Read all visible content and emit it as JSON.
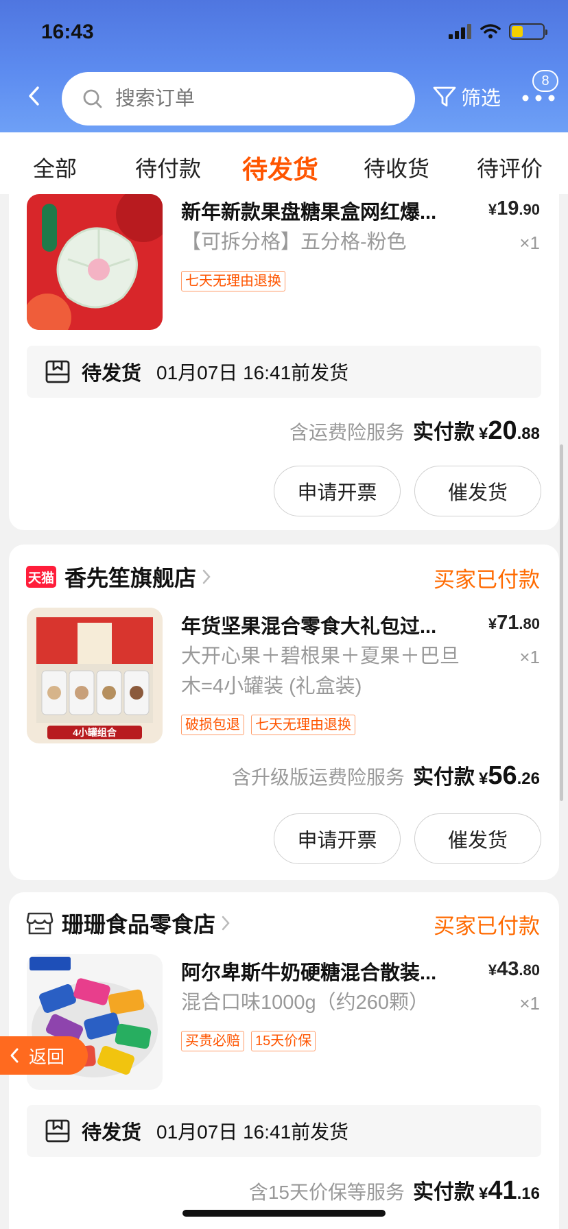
{
  "status_bar": {
    "time": "16:43"
  },
  "header": {
    "search_placeholder": "搜索订单",
    "filter_label": "筛选",
    "more_badge": "8"
  },
  "tabs": [
    {
      "label": "全部",
      "active": false
    },
    {
      "label": "待付款",
      "active": false
    },
    {
      "label": "待发货",
      "active": true
    },
    {
      "label": "待收货",
      "active": false
    },
    {
      "label": "待评价",
      "active": false
    }
  ],
  "orders": [
    {
      "product_title": "新年新款果盘糖果盒网红爆...",
      "price_int": "19",
      "price_dec": ".90",
      "currency": "¥",
      "sku": "【可拆分格】五分格-粉色",
      "qty": "×1",
      "tags": [
        "七天无理由退换"
      ],
      "ship_label": "待发货",
      "ship_time": "01月07日 16:41前发货",
      "service": "含运费险服务",
      "paid_label": "实付款",
      "total_int": "20",
      "total_dec": ".88",
      "buttons": [
        "申请开票",
        "催发货"
      ]
    },
    {
      "store": "香先笙旗舰店",
      "store_logo": "天猫",
      "status": "买家已付款",
      "product_title": "年货坚果混合零食大礼包过...",
      "price_int": "71",
      "price_dec": ".80",
      "currency": "¥",
      "sku": "大开心果＋碧根果＋夏果＋巴旦木=4小罐装 (礼盒装)",
      "qty": "×1",
      "tags": [
        "破损包退",
        "七天无理由退换"
      ],
      "image_caption": "4小罐组合",
      "service": "含升级版运费险服务",
      "paid_label": "实付款",
      "total_int": "56",
      "total_dec": ".26",
      "buttons": [
        "申请开票",
        "催发货"
      ]
    },
    {
      "store": "珊珊食品零食店",
      "status": "买家已付款",
      "product_title": "阿尔卑斯牛奶硬糖混合散装...",
      "price_int": "43",
      "price_dec": ".80",
      "currency": "¥",
      "sku": "混合口味1000g（约260颗）",
      "qty": "×1",
      "tags": [
        "买贵必赔",
        "15天价保"
      ],
      "ship_label": "待发货",
      "ship_time": "01月07日 16:41前发货",
      "service": "含15天价保等服务",
      "paid_label": "实付款",
      "total_int": "41",
      "total_dec": ".16"
    }
  ],
  "float_back": {
    "label": "返回"
  },
  "colors": {
    "accent": "#ff5500",
    "header_top": "#4f76e0",
    "header_bottom": "#6ea0f6",
    "status_orange": "#ff6a00"
  }
}
